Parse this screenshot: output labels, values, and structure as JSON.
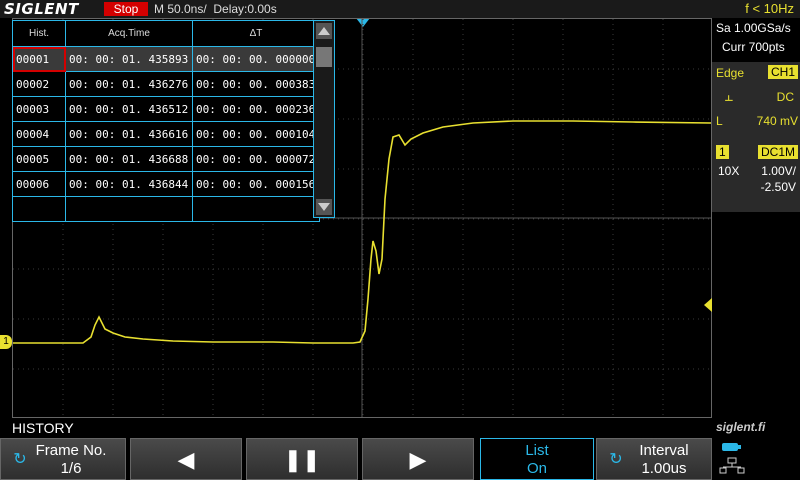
{
  "top_bar": {
    "logo": "SIGLENT",
    "status": "Stop",
    "timebase": "M 50.0ns/  Delay:0.00s",
    "frequency": "f < 10Hz"
  },
  "right_panel": {
    "sample_rate": "Sa 1.00GSa/s",
    "memory": "Curr 700pts",
    "trigger_type": "Edge",
    "trigger_source": "CH1",
    "trigger_coupling": "DC",
    "trigger_level_label": "L",
    "trigger_level": "740 mV",
    "channel_number": "1",
    "channel_coupling": "DC1M",
    "probe": "10X",
    "vdiv": "1.00V/",
    "offset": "-2.50V"
  },
  "history_table": {
    "headers": [
      "Hist.",
      "Acq.Time",
      "ΔT"
    ],
    "rows": [
      [
        "00001",
        "00: 00: 01. 435893",
        "00: 00: 00. 000000"
      ],
      [
        "00002",
        "00: 00: 01. 436276",
        "00: 00: 00. 000383"
      ],
      [
        "00003",
        "00: 00: 01. 436512",
        "00: 00: 00. 000236"
      ],
      [
        "00004",
        "00: 00: 01. 436616",
        "00: 00: 00. 000104"
      ],
      [
        "00005",
        "00: 00: 01. 436688",
        "00: 00: 00. 000072"
      ],
      [
        "00006",
        "00: 00: 01. 436844",
        "00: 00: 00. 000156"
      ]
    ],
    "selected_row": 0
  },
  "channel_marker": "1",
  "menu_title": "HISTORY",
  "watermark": "siglent.fi",
  "softkeys": {
    "frame_label": "Frame No.",
    "frame_value": "1/6",
    "prev_icon": "previous-icon",
    "pause_icon": "pause-icon",
    "next_icon": "next-icon",
    "list_label": "List",
    "list_value": "On",
    "interval_label": "Interval",
    "interval_value": "1.00us"
  },
  "colors": {
    "trace": "#e8e030",
    "accent": "#2bb8e8",
    "stop": "#d40000"
  }
}
